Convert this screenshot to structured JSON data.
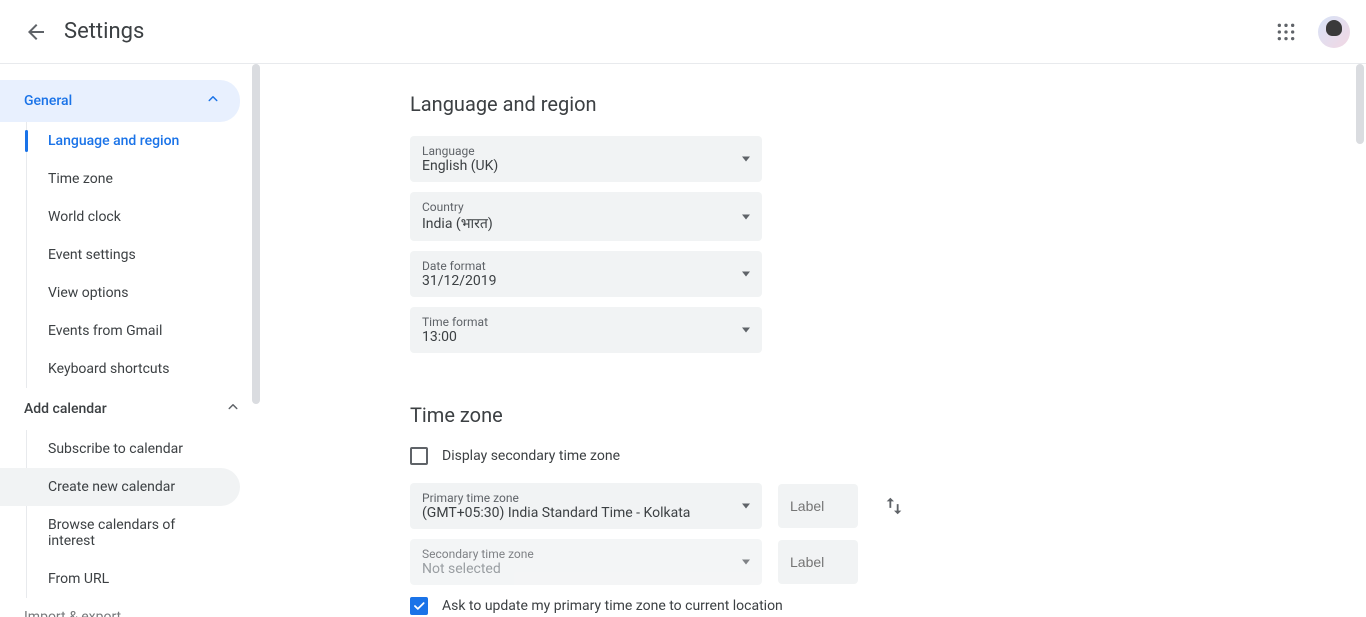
{
  "header": {
    "title": "Settings"
  },
  "sidebar": {
    "general_label": "General",
    "general_items": [
      "Language and region",
      "Time zone",
      "World clock",
      "Event settings",
      "View options",
      "Events from Gmail",
      "Keyboard shortcuts"
    ],
    "add_calendar_label": "Add calendar",
    "add_calendar_items": [
      "Subscribe to calendar",
      "Create new calendar",
      "Browse calendars of interest",
      "From URL"
    ],
    "truncated_item": "Import & export"
  },
  "lang_region": {
    "title": "Language and region",
    "language_label": "Language",
    "language_value": "English (UK)",
    "country_label": "Country",
    "country_value": "India (भारत)",
    "date_format_label": "Date format",
    "date_format_value": "31/12/2019",
    "time_format_label": "Time format",
    "time_format_value": "13:00"
  },
  "timezone": {
    "title": "Time zone",
    "display_secondary_label": "Display secondary time zone",
    "display_secondary_checked": false,
    "primary_label": "Primary time zone",
    "primary_value": "(GMT+05:30) India Standard Time - Kolkata",
    "secondary_label": "Secondary time zone",
    "secondary_value": "Not selected",
    "label_placeholder": "Label",
    "ask_update_label": "Ask to update my primary time zone to current location",
    "ask_update_checked": true
  }
}
